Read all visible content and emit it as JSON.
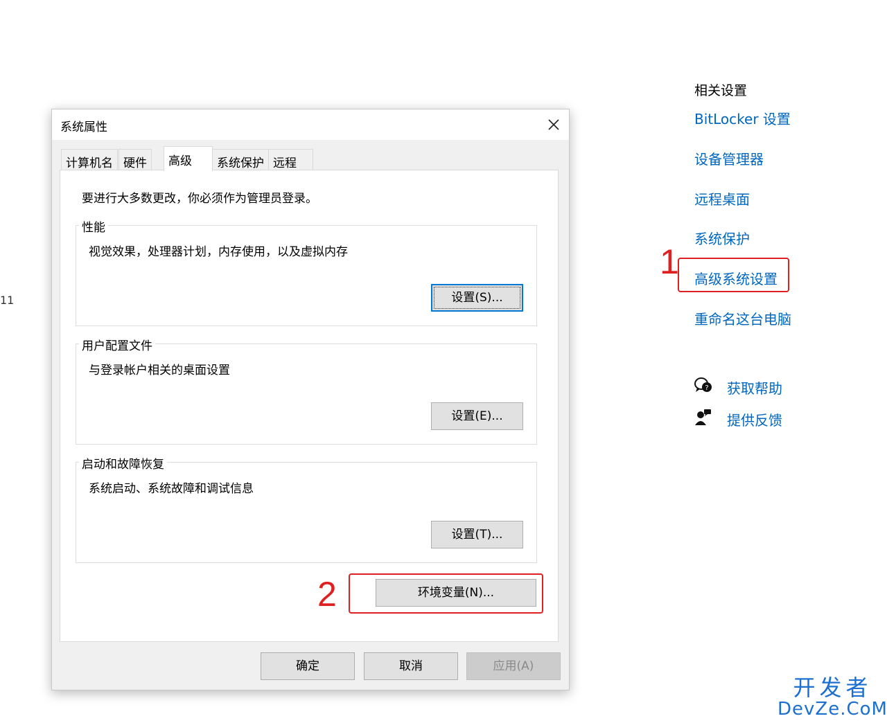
{
  "edge_text": "11",
  "dialog": {
    "title": "系统属性",
    "tabs": [
      {
        "label": "计算机名"
      },
      {
        "label": "硬件"
      },
      {
        "label": "高级"
      },
      {
        "label": "系统保护"
      },
      {
        "label": "远程"
      }
    ],
    "active_tab": "高级",
    "notice": "要进行大多数更改，你必须作为管理员登录。",
    "groups": [
      {
        "label": "性能",
        "description": "视觉效果，处理器计划，内存使用，以及虚拟内存",
        "button": "设置(S)..."
      },
      {
        "label": "用户配置文件",
        "description": "与登录帐户相关的桌面设置",
        "button": "设置(E)..."
      },
      {
        "label": "启动和故障恢复",
        "description": "系统启动、系统故障和调试信息",
        "button": "设置(T)..."
      }
    ],
    "env_button": "环境变量(N)...",
    "footer": {
      "ok": "确定",
      "cancel": "取消",
      "apply": "应用(A)"
    }
  },
  "annotations": {
    "one": "1",
    "two": "2",
    "color": "#e02020"
  },
  "related": {
    "title": "相关设置",
    "links": [
      {
        "label": "BitLocker 设置"
      },
      {
        "label": "设备管理器"
      },
      {
        "label": "远程桌面"
      },
      {
        "label": "系统保护"
      },
      {
        "label": "高级系统设置"
      },
      {
        "label": "重命名这台电脑"
      }
    ],
    "help": [
      {
        "label": "获取帮助",
        "icon": "help-chat-icon"
      },
      {
        "label": "提供反馈",
        "icon": "feedback-icon"
      }
    ],
    "link_color": "#0067c0"
  },
  "watermark": {
    "line1": "开发者",
    "line2": "DevZe.CoM"
  }
}
